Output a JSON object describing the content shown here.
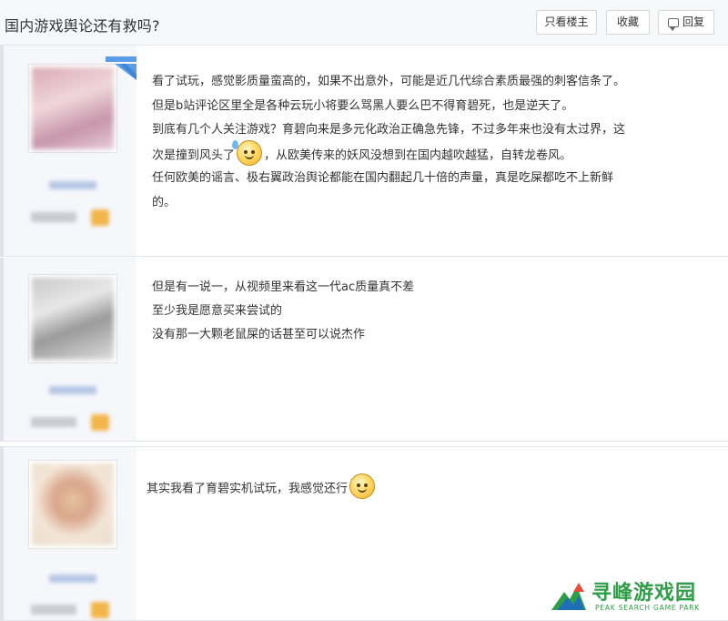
{
  "thread": {
    "title": "国内游戏舆论还有救吗?",
    "buttons": {
      "only_op": "只看楼主",
      "favorite": "收藏",
      "reply": "回复"
    }
  },
  "posts": [
    {
      "avatar_icon": "avatar-blurred",
      "lines": [
        "看了试玩，感觉影质量蛮高的，如果不出意外，可能是近几代综合素质最强的刺客信条了。",
        "但是b站评论区里全是各种云玩小将要么骂黑人要么巴不得育碧死，也是逆天了。",
        "到底有几个人关注游戏？育碧向来是多元化政治正确急先锋，不过多年来也没有太过界，这",
        [
          "次是撞到风头了",
          "，从欧美传来的妖风没想到在国内越吹越猛，自转龙卷风。"
        ],
        "任何欧美的谣言、极右翼政治舆论都能在国内翻起几十倍的声量，真是吃屎都吃不上新鲜",
        "的。"
      ],
      "emoji": "sweat-smile-emoji"
    },
    {
      "avatar_icon": "avatar-blurred",
      "lines": [
        "但是有一说一，从视频里来看这一代ac质量真不差",
        "至少我是愿意买来尝试的",
        "没有那一大颗老鼠屎的话甚至可以说杰作"
      ]
    },
    {
      "avatar_icon": "avatar-blurred",
      "lines": [
        "其实我看了育碧实机试玩，我感觉还行"
      ],
      "emoji": "smile-emoji"
    }
  ],
  "watermark": {
    "title": "寻峰游戏园",
    "subtitle": "PEAK SEARCH GAME PARK"
  },
  "colors": {
    "accent_blue": "#5b9ce6",
    "watermark_green": "#2e9e48"
  }
}
